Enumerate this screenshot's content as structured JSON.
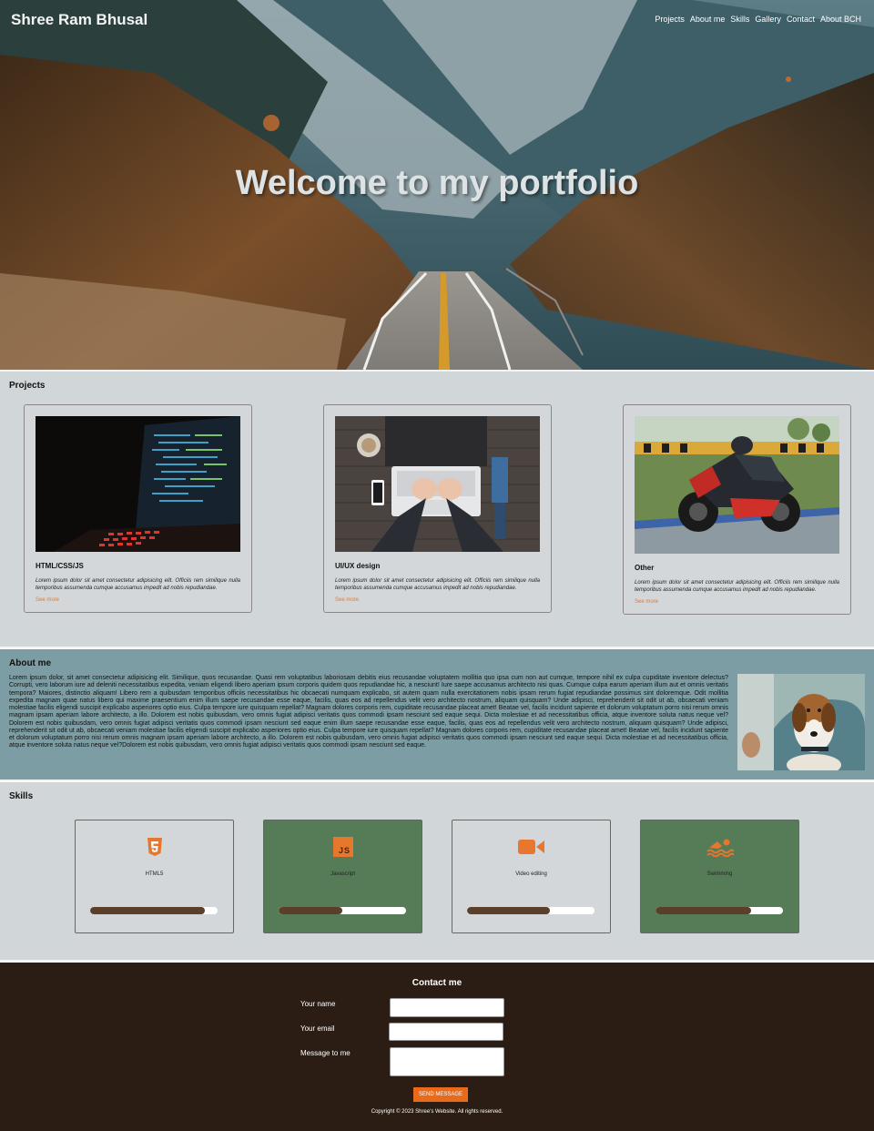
{
  "header": {
    "brand": "Shree Ram Bhusal",
    "nav": [
      "Projects",
      "About me",
      "Skills",
      "Gallery",
      "Contact",
      "About BCH"
    ]
  },
  "hero": {
    "title": "Welcome to my portfolio"
  },
  "projects": {
    "title": "Projects",
    "cards": [
      {
        "title": "HTML/CSS/JS",
        "text": "Lorem ipsum dolor sit amet consectetur adipisicing elit. Officiis rem similique nulla temporibus assumenda cumque accusamus impedit ad nobis repudiandae.",
        "link": "See more"
      },
      {
        "title": "UI/UX design",
        "text": "Lorem ipsum dolor sit amet consectetur adipisicing elit. Officiis rem similique nulla temporibus assumenda cumque accusamus impedit ad nobis repudiandae.",
        "link": "See more"
      },
      {
        "title": "Other",
        "text": "Lorem ipsum dolor sit amet consectetur adipisicing elit. Officiis rem similique nulla temporibus assumenda cumque accusamus impedit ad nobis repudiandae.",
        "link": "See more"
      }
    ]
  },
  "about": {
    "title": "About me",
    "text": "Lorem ipsum dolor, sit amet consectetur adipisicing elit. Similique, quos recusandae. Quasi rem voluptatibus laboriosam debitis eius recusandae voluptatem mollitia quo ipsa cum non aut cumque, tempore nihil ex culpa cupiditate inventore delectus? Corrupti, vero laborum iure ad deleniti necessitatibus expedita, veniam eligendi libero aperiam ipsum corporis quidem quos repudiandae hic, a nesciunt! Iure saepe accusamus architecto nisi quas. Cumque culpa earum aperiam illum aut et omnis veritatis tempora? Maiores, distinctio aliquam! Libero rem a quibusdam temporibus officiis necessitatibus hic obcaecati numquam explicabo, sit autem quam nulla exercitationem nobis ipsam rerum fugiat repudiandae possimus sint doloremque. Odit mollitia expedita magnam quae natus libero qui maxime praesentium enim illum saepe recusandae esse eaque, facilis, quas eos ad repellendus velit vero architecto nostrum, aliquam quisquam? Unde adipisci, reprehenderit sit odit ut ab, obcaecati veniam molestiae facilis eligendi suscipit explicabo asperiores optio eius. Culpa tempore iure quisquam repellat? Magnam dolores corporis rem, cupiditate recusandae placeat amet! Beatae vel, facilis incidunt sapiente et dolorum voluptatum porro nisi rerum omnis magnam ipsam aperiam labore architecto, a illo. Dolorem est nobis quibusdam, vero omnis fugiat adipisci veritatis quos commodi ipsam nesciunt sed eaque sequi. Dicta molestiae et ad necessitatibus officia, atque inventore soluta natus neque vel?Dolorem est nobis quibusdam, vero omnis fugiat adipisci veritatis quos commodi ipsam nesciunt sed eaque enim illum saepe recusandae esse eaque, facilis, quas eos ad repellendus velit vero architecto nostrum, aliquam quisquam? Unde adipisci, reprehenderit sit odit ut ab, obcaecati veniam molestiae facilis eligendi suscipit explicabo asperiores optio eius. Culpa tempore iure quisquam repellat? Magnam dolores corporis rem, cupiditate recusandae placeat amet! Beatae vel, facilis incidunt sapiente et dolorum voluptatum porro nisi rerum omnis magnam ipsam aperiam labore architecto, a illo. Dolorem est nobis quibusdam, vero omnis fugiat adipisci veritatis quos commodi ipsam nesciunt sed eaque sequi. Dicta molestiae et ad necessitatibus officia, atque inventore soluta natus neque vel?Dolorem est nobis quibusdam, vero omnis fugiat adipisci veritatis quos commodi ipsam nesciunt sed eaque."
  },
  "skills": {
    "title": "Skills",
    "items": [
      {
        "label": "HTML5",
        "icon": "html5-icon",
        "level": 0.9
      },
      {
        "label": "Javascript",
        "icon": "javascript-icon",
        "level": 0.5
      },
      {
        "label": "Video editing",
        "icon": "video-camera-icon",
        "level": 0.65
      },
      {
        "label": "Swimming",
        "icon": "swimmer-icon",
        "level": 0.75
      }
    ]
  },
  "contact": {
    "title": "Contact me",
    "name_label": "Your name",
    "email_label": "Your email",
    "message_label": "Message to me",
    "submit": "SEND MESSAGE",
    "copyright": "Copyright © 2023 Shree's Website. All rights reserved."
  },
  "colors": {
    "accent": "#e86a1a",
    "section_bg": "#d1d6d8",
    "about_bg": "#7c9da3",
    "skill_green": "#557b57",
    "skill_bar": "#5a3f2b",
    "footer_bg": "#2b1d14"
  }
}
